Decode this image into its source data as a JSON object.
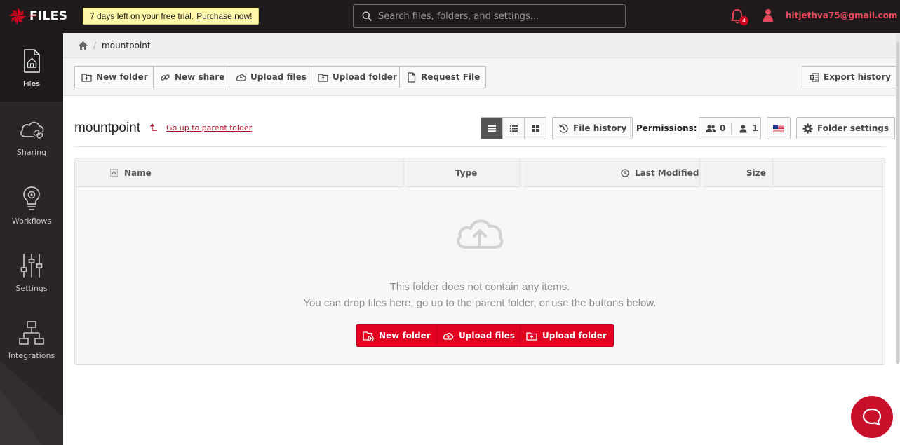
{
  "app": {
    "logo_text": "FILES",
    "logo_sub": ".com",
    "trial_text": "7 days left on your free trial.",
    "trial_link": "Purchase now!",
    "search_placeholder": "Search files, folders, and settings...",
    "notification_count": "4",
    "user_email": "hitjethva75@gmail.com",
    "brand_color": "#d0021b"
  },
  "sidebar": {
    "items": [
      {
        "label": "Files",
        "icon": "files-icon",
        "active": true
      },
      {
        "label": "Sharing",
        "icon": "cloud-link-icon"
      },
      {
        "label": "Workflows",
        "icon": "lightbulb-gear-icon"
      },
      {
        "label": "Settings",
        "icon": "sliders-icon"
      },
      {
        "label": "Integrations",
        "icon": "network-icon"
      }
    ]
  },
  "breadcrumb": {
    "home_icon": "home-icon",
    "separator": "/",
    "current": "mountpoint"
  },
  "toolbar": {
    "new_folder": "New folder",
    "new_share": "New share",
    "upload_files": "Upload files",
    "upload_folder": "Upload folder",
    "request_file": "Request File",
    "export_history": "Export history"
  },
  "folder": {
    "title": "mountpoint",
    "parent_link": "Go up to parent folder",
    "file_history": "File history",
    "permissions_label": "Permissions:",
    "group_count": "0",
    "user_count": "1",
    "language_flag": "us-flag-icon",
    "folder_settings": "Folder settings",
    "view_mode": "list"
  },
  "table": {
    "columns": [
      "Name",
      "Type",
      "Last Modified",
      "Size"
    ],
    "empty_line1": "This folder does not contain any items.",
    "empty_line2": "You can drop files here, go up to the parent folder, or use the buttons below.",
    "new_folder": "New folder",
    "upload_files": "Upload files",
    "upload_folder": "Upload folder"
  }
}
